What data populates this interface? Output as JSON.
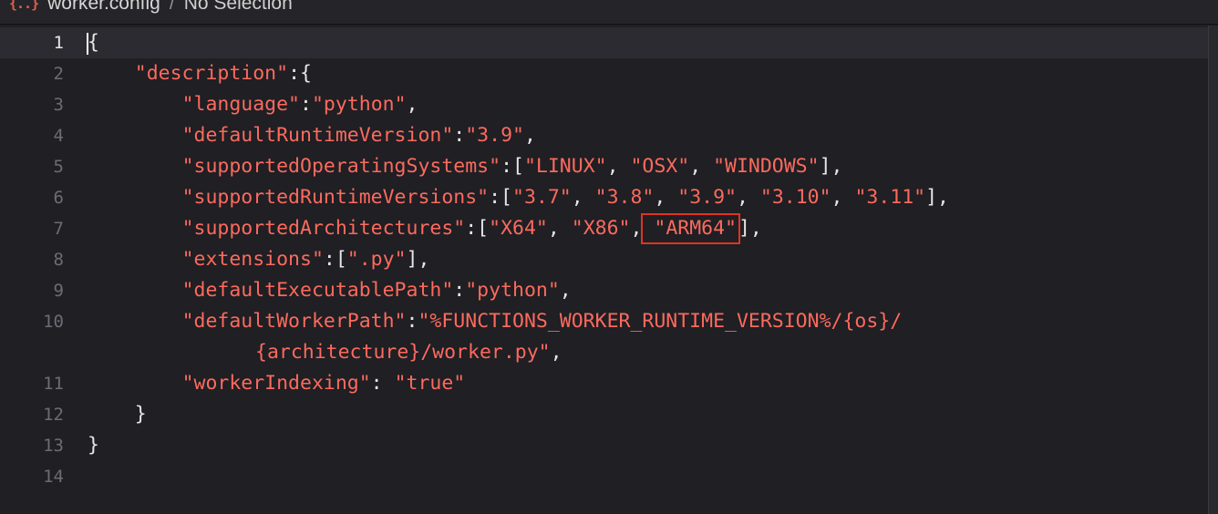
{
  "breadcrumb": {
    "file_icon": "{..}",
    "file_name": "worker.config",
    "separator": "/",
    "selection": "No Selection"
  },
  "editor": {
    "language": "json",
    "current_line": 1,
    "highlight": {
      "line": 7,
      "text": "\"ARM64\"",
      "color": "#e03420"
    },
    "lines": [
      {
        "number": "1"
      },
      {
        "number": "2"
      },
      {
        "number": "3"
      },
      {
        "number": "4"
      },
      {
        "number": "5"
      },
      {
        "number": "6"
      },
      {
        "number": "7"
      },
      {
        "number": "8"
      },
      {
        "number": "9"
      },
      {
        "number": "10"
      },
      {
        "number": "11"
      },
      {
        "number": "12"
      },
      {
        "number": "13"
      },
      {
        "number": "14"
      }
    ],
    "tokens": {
      "l1_brace": "{",
      "l2_key": "\"description\"",
      "l2_tail": ":{",
      "l3_key": "\"language\"",
      "l3_colon": ":",
      "l3_val": "\"python\"",
      "l3_comma": ",",
      "l4_key": "\"defaultRuntimeVersion\"",
      "l4_colon": ":",
      "l4_val": "\"3.9\"",
      "l4_comma": ",",
      "l5_key": "\"supportedOperatingSystems\"",
      "l5_open": ":[",
      "l5_v1": "\"LINUX\"",
      "l5_sep1": ", ",
      "l5_v2": "\"OSX\"",
      "l5_sep2": ", ",
      "l5_v3": "\"WINDOWS\"",
      "l5_close": "],",
      "l6_key": "\"supportedRuntimeVersions\"",
      "l6_open": ":[",
      "l6_v1": "\"3.7\"",
      "l6_sep1": ", ",
      "l6_v2": "\"3.8\"",
      "l6_sep2": ", ",
      "l6_v3": "\"3.9\"",
      "l6_sep3": ", ",
      "l6_v4": "\"3.10\"",
      "l6_sep4": ", ",
      "l6_v5": "\"3.11\"",
      "l6_close": "],",
      "l7_key": "\"supportedArchitectures\"",
      "l7_open": ":[",
      "l7_v1": "\"X64\"",
      "l7_sep1": ", ",
      "l7_v2": "\"X86\"",
      "l7_sep2": ", ",
      "l7_v3": "\"ARM64\"",
      "l7_close": "],",
      "l8_key": "\"extensions\"",
      "l8_open": ":[",
      "l8_v1": "\".py\"",
      "l8_close": "],",
      "l9_key": "\"defaultExecutablePath\"",
      "l9_colon": ":",
      "l9_val": "\"python\"",
      "l9_comma": ",",
      "l10_key": "\"defaultWorkerPath\"",
      "l10_colon": ":",
      "l10_val_a": "\"%FUNCTIONS_WORKER_RUNTIME_VERSION%/{os}/",
      "l10_val_b": "{architecture}/worker.py\"",
      "l10_comma": ",",
      "l11_key": "\"workerIndexing\"",
      "l11_colon": ": ",
      "l11_val": "\"true\"",
      "l12_brace": "}",
      "l13_brace": "}"
    }
  },
  "colors": {
    "background": "#1f1f24",
    "current_line": "#2b2b31",
    "string": "#fc6a5d",
    "punctuation": "#e6e6e6",
    "gutter": "#6c6c74",
    "highlight_box": "#e03420"
  }
}
